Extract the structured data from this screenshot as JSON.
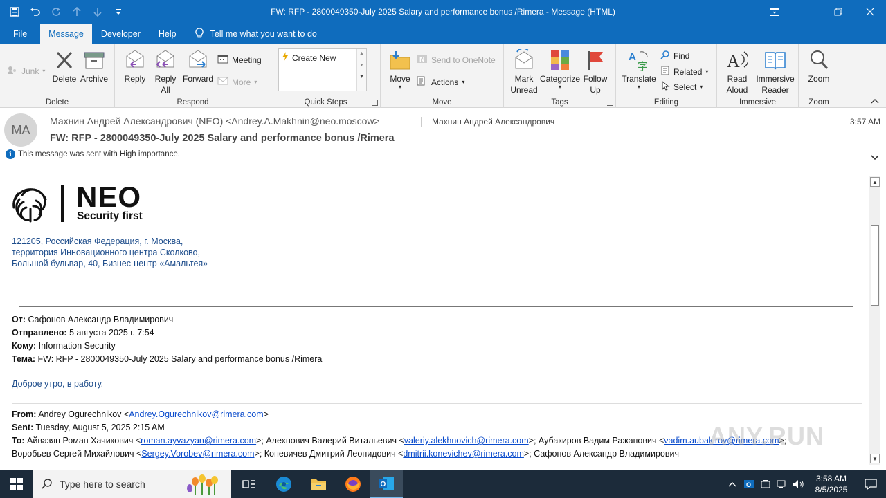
{
  "window": {
    "title": "FW: RFP - 2800049350-July 2025 Salary and performance bonus /Rimera  -  Message (HTML)"
  },
  "menu": {
    "file": "File",
    "message": "Message",
    "developer": "Developer",
    "help": "Help",
    "tell_me": "Tell me what you want to do"
  },
  "ribbon": {
    "delete_group": {
      "label": "Delete",
      "junk": "Junk",
      "delete": "Delete",
      "archive": "Archive"
    },
    "respond_group": {
      "label": "Respond",
      "reply": "Reply",
      "reply_all_1": "Reply",
      "reply_all_2": "All",
      "forward": "Forward",
      "meeting": "Meeting",
      "more": "More"
    },
    "quick_steps": {
      "label": "Quick Steps",
      "create_new": "Create New"
    },
    "move_group": {
      "label": "Move",
      "move": "Move",
      "onenote": "Send to OneNote",
      "actions": "Actions"
    },
    "tags_group": {
      "label": "Tags",
      "mark_1": "Mark",
      "mark_2": "Unread",
      "categorize": "Categorize",
      "follow_1": "Follow",
      "follow_2": "Up"
    },
    "editing_group": {
      "label": "Editing",
      "translate": "Translate",
      "find": "Find",
      "related": "Related",
      "select": "Select"
    },
    "immersive_group": {
      "label": "Immersive",
      "read_1": "Read",
      "read_2": "Aloud",
      "immersive_1": "Immersive",
      "immersive_2": "Reader"
    },
    "zoom_group": {
      "label": "Zoom",
      "zoom": "Zoom"
    }
  },
  "header": {
    "avatar_initials": "MA",
    "from": "Махнин Андрей Александрович (NEO) <Andrey.A.Makhnin@neo.moscow>",
    "to": "Махнин Андрей Александрович",
    "time": "3:57 AM",
    "subject": "FW: RFP - 2800049350-July 2025 Salary and performance bonus /Rimera",
    "importance": "This message was sent with High importance."
  },
  "body": {
    "logo_title": "NEO",
    "logo_tagline": "Security first",
    "address": [
      "121205, Российская Федерация, г. Москва,",
      "территория Инновационного центра Сколково,",
      "Большой бульвар, 40, Бизнес-центр «Амальтея»"
    ],
    "fw1": {
      "from_label": "От:",
      "from": "Сафонов Александр Владимирович",
      "sent_label": "Отправлено:",
      "sent": "5 августа 2025 г. 7:54",
      "to_label": "Кому:",
      "to": "Information Security",
      "subject_label": "Тема:",
      "subject": "FW: RFP - 2800049350-July 2025 Salary and performance bonus /Rimera"
    },
    "greeting": "Доброе утро, в работу.",
    "fw2": {
      "from_label": "From:",
      "from_name": "Andrey Ogurechnikov <",
      "from_email": "Andrey.Ogurechnikov@rimera.com",
      "from_end": ">",
      "sent_label": "Sent:",
      "sent": "Tuesday, August 5, 2025 2:15 AM",
      "to_label": "To:",
      "r1_name": "Айвазян Роман Хачикович <",
      "r1_email": "roman.ayvazyan@rimera.com",
      "r2_name": ">; Алехнович Валерий Витальевич <",
      "r2_email": "valeriy.alekhnovich@rimera.com",
      "r3_name": ">; Аубакиров Вадим Ражапович <",
      "r3_email": "vadim.aubakirov@rimera.com",
      "r3_end": ">;",
      "r4_name": "Воробьев Сергей Михайлович <",
      "r4_email": "Sergey.Vorobev@rimera.com",
      "r5_name": ">; Коневичев Дмитрий Леонидович <",
      "r5_email": "dmitrii.konevichev@rimera.com",
      "r6_name": ">; Сафонов Александр Владимирович"
    }
  },
  "watermark": "ANY.RUN",
  "taskbar": {
    "search_placeholder": "Type here to search",
    "time": "3:58 AM",
    "date": "8/5/2025"
  },
  "colors": {
    "accent": "#0f6cbd",
    "link": "#0a4bcc",
    "address": "#1f4e8c"
  }
}
